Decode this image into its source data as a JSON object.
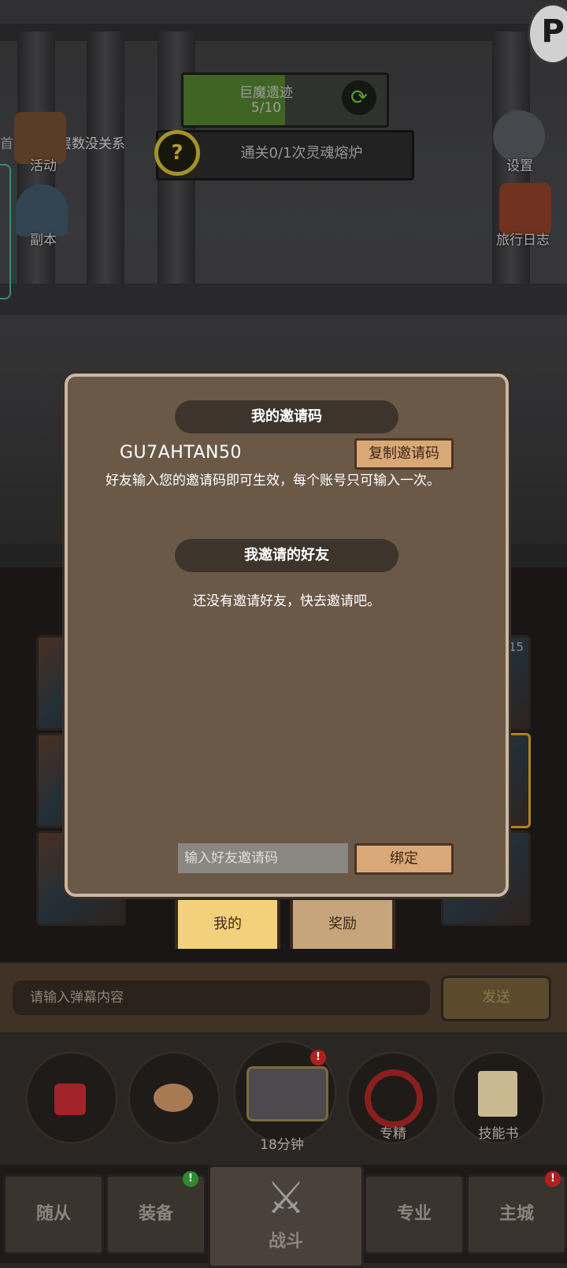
{
  "hud": {
    "quest_name": "巨魔遗迹",
    "quest_progress": "5/10",
    "quest_fill": 0.5,
    "task_text": "通关0/1次灵魂熔炉",
    "ticker_text": "扫荡和层数没关系",
    "left_items": [
      "活动",
      "副本"
    ],
    "right_items": [
      "设置",
      "旅行日志"
    ]
  },
  "dialog": {
    "my_code_title": "我的邀请码",
    "code": "GU7AHTAN50",
    "copy_button": "复制邀请码",
    "note": "好友输入您的邀请码即可生效，每个账号只可输入一次。",
    "friends_title": "我邀请的好友",
    "empty_text": "还没有邀请好友，快去邀请吧。",
    "input_placeholder": "输入好友邀请码",
    "bind_button": "绑定"
  },
  "tabs": [
    "我的",
    "奖励"
  ],
  "background_badge": "15",
  "chat": {
    "placeholder": "请输入弹幕内容",
    "send": "发送"
  },
  "tools": {
    "chest_timer": "18分钟",
    "specialize": "专精",
    "skill_book": "技能书"
  },
  "nav": {
    "follower": "随从",
    "equipment": "装备",
    "battle": "战斗",
    "profession": "专业",
    "city": "主城"
  },
  "colors": {
    "dialog_bg": "#6b5948",
    "tab_active": "#f3d07c",
    "button_wood": "#d9a877"
  }
}
